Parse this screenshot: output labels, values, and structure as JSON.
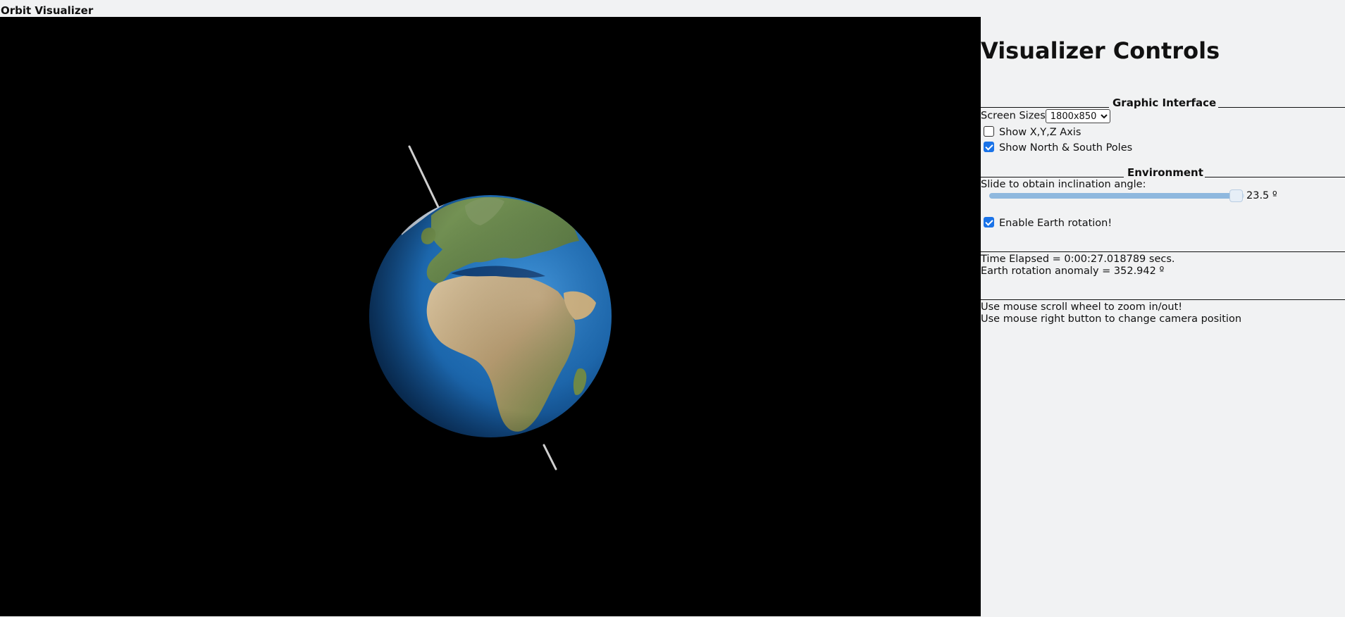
{
  "app": {
    "title": "Orbit Visualizer"
  },
  "viewport": {
    "background": "#000000",
    "earth_icon": "earth-globe",
    "show_poles": true
  },
  "controls": {
    "title": "Visualizer Controls",
    "graphic_interface": {
      "header": "Graphic Interface",
      "screen_sizes_label": "Screen Sizes",
      "screen_size_selected": "1800x850",
      "show_axis_label": "Show X,Y,Z Axis",
      "show_axis_checked": false,
      "show_poles_label": "Show North & South Poles",
      "show_poles_checked": true
    },
    "environment": {
      "header": "Environment",
      "slider_label": "Slide to obtain inclination angle:",
      "inclination_value": "23.5 º",
      "inclination_fraction": 0.97,
      "rotation_label": "Enable Earth rotation!",
      "rotation_checked": true
    },
    "status": {
      "time_elapsed": "Time Elapsed = 0:00:27.018789 secs.",
      "rotation_anomaly": "Earth rotation anomaly = 352.942 º"
    },
    "help": {
      "zoom": "Use mouse scroll wheel to zoom in/out!",
      "camera": "Use mouse right button to change camera position"
    }
  },
  "colors": {
    "accent": "#1a73e8",
    "slider_fill": "#8fb8de",
    "page_background": "#f1f2f3"
  }
}
